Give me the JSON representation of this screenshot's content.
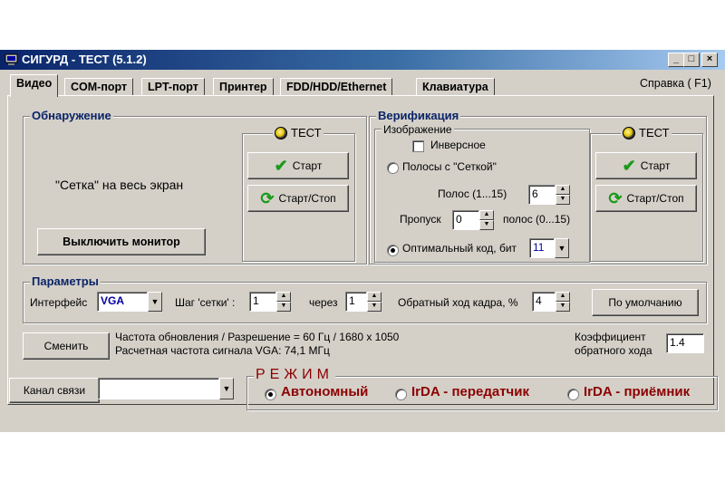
{
  "window": {
    "title": "СИГУРД - ТЕСТ (5.1.2)",
    "minimize_icon": "minimize-icon",
    "maximize_icon": "maximize-icon",
    "close_icon": "close-icon"
  },
  "menu": {
    "help": "Справка ( F1)"
  },
  "tabs": [
    {
      "label": "Видео",
      "active": true
    },
    {
      "label": "COM-порт"
    },
    {
      "label": "LPT-порт"
    },
    {
      "label": "Принтер"
    },
    {
      "label": "FDD/HDD/Ethernet"
    },
    {
      "label": "Клавиатура"
    }
  ],
  "detection": {
    "title": "Обнаружение",
    "message": "\"Сетка\" на весь экран",
    "monitor_off_button": "Выключить монитор",
    "test_label": "ТЕСТ",
    "start_button": "Старт",
    "startstop_button": "Старт/Стоп"
  },
  "verification": {
    "title": "Верификация",
    "image_label": "Изображение",
    "inverse_label": "Инверсное",
    "inverse_checked": false,
    "stripes_radio": "Полосы с \"Сеткой\"",
    "stripes_count_label": "Полос (1...15)",
    "stripes_count": "6",
    "skip_label": "Пропуск",
    "skip_value": "0",
    "skip_suffix": "полос (0...15)",
    "optimal_radio": "Оптимальный код, бит",
    "optimal_bits": "11",
    "test_label": "ТЕСТ",
    "start_button": "Старт",
    "startstop_button": "Старт/Стоп"
  },
  "params": {
    "title": "Параметры",
    "interface_label": "Интерфейс",
    "interface_value": "VGA",
    "grid_step_label": "Шаг 'сетки' :",
    "grid_step": "1",
    "through_label": "через",
    "through_value": "1",
    "retrace_label": "Обратный ход кадра, %",
    "retrace_value": "4",
    "default_button": "По умолчанию"
  },
  "info": {
    "change_button": "Сменить",
    "line1": "Частота обновления / Разрешение  =  60 Гц / 1680 x 1050",
    "line2": "Расчетная частота сигнала VGA: 74,1 МГц",
    "coef_label1": "Коэффициент",
    "coef_label2": "обратного хода",
    "coef_value": "1.4"
  },
  "bottom": {
    "channel_button": "Канал связи",
    "channel_value": "",
    "mode_title": "РЕЖИМ",
    "modes": [
      {
        "label": "Автономный",
        "selected": true
      },
      {
        "label": "IrDA - передатчик",
        "selected": false
      },
      {
        "label": "IrDA - приёмник",
        "selected": false
      }
    ]
  },
  "colors": {
    "title_start": "#0a246a",
    "title_end": "#a6caf0",
    "face": "#d4d0c8",
    "mode_red": "#8b0000",
    "group_blue": "#0a2468"
  }
}
